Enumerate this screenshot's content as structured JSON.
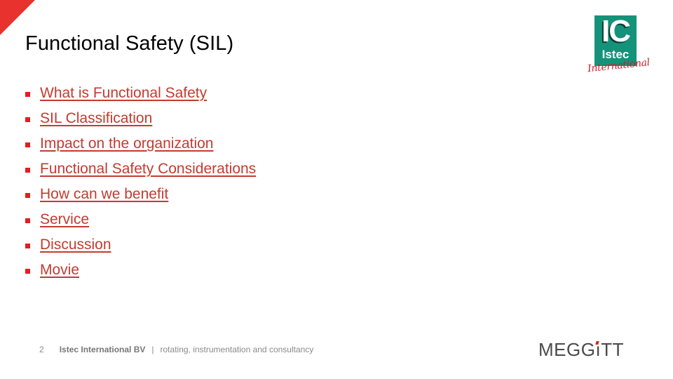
{
  "slide": {
    "title": "Functional Safety (SIL)",
    "accent_color": "#e8322d",
    "link_color": "#c33b2f",
    "bullet_color": "#e21e1e"
  },
  "agenda": {
    "items": [
      {
        "label": "What is Functional Safety"
      },
      {
        "label": "SIL Classification"
      },
      {
        "label": "Impact on the organization"
      },
      {
        "label": "Functional Safety Considerations"
      },
      {
        "label": "How can we benefit"
      },
      {
        "label": "Service"
      },
      {
        "label": "Discussion"
      },
      {
        "label": "Movie"
      }
    ]
  },
  "logo_istec": {
    "mark": "IC",
    "name": "Istec",
    "tagline": "International",
    "brand_color": "#14927a"
  },
  "footer": {
    "page_number": "2",
    "company": "Istec International BV",
    "separator": "|",
    "tagline": "rotating, instrumentation and consultancy"
  },
  "logo_meggitt": {
    "before_i": "MEGG",
    "i": "ı",
    "after_i": "TT"
  }
}
